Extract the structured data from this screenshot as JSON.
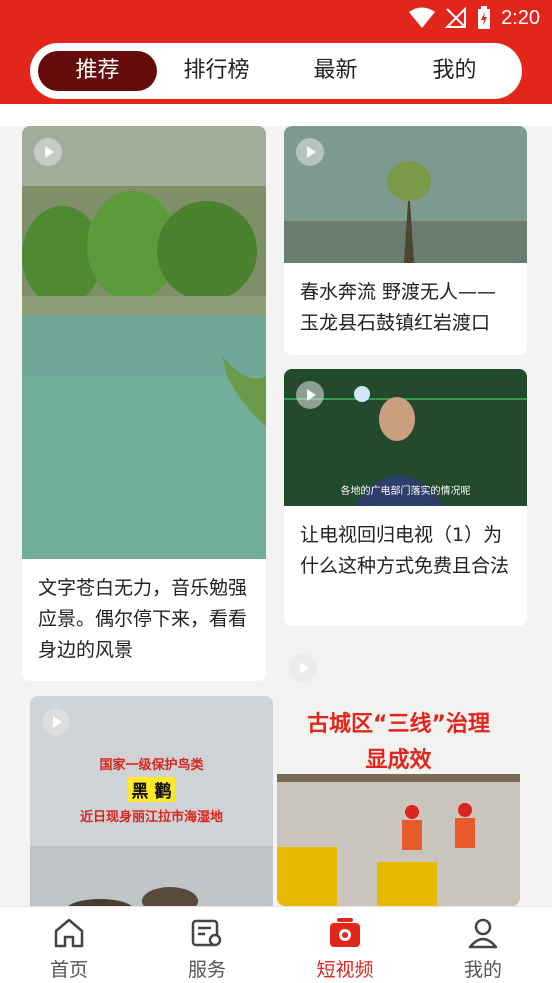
{
  "status": {
    "time": "2:20"
  },
  "tabs": [
    {
      "label": "推荐",
      "active": true
    },
    {
      "label": "排行榜",
      "active": false
    },
    {
      "label": "最新",
      "active": false
    },
    {
      "label": "我的",
      "active": false
    }
  ],
  "feed": {
    "left": [
      {
        "title": "文字苍白无力，音乐勉强应景。偶尔停下来，看看身边的风景"
      },
      {
        "overlay_line1": "国家一级保护鸟类",
        "overlay_line2": "黑 鹳",
        "overlay_line3": "近日现身丽江拉市海湿地"
      }
    ],
    "right": [
      {
        "title": "春水奔流 野渡无人——玉龙县石鼓镇红岩渡口"
      },
      {
        "title": "让电视回归电视（1）为什么这种方式免费且合法",
        "subtitle": "各地的广电部门落实的情况呢"
      },
      {
        "overlay_line1": "古城区“三线”治理",
        "overlay_line2": "显成效"
      }
    ]
  },
  "bottom_nav": [
    {
      "label": "首页",
      "icon": "home-icon"
    },
    {
      "label": "服务",
      "icon": "service-icon"
    },
    {
      "label": "短视频",
      "icon": "short-video-icon",
      "active": true
    },
    {
      "label": "我的",
      "icon": "profile-icon"
    }
  ],
  "colors": {
    "brand": "#e3261c",
    "active_tab": "#650b0b"
  }
}
